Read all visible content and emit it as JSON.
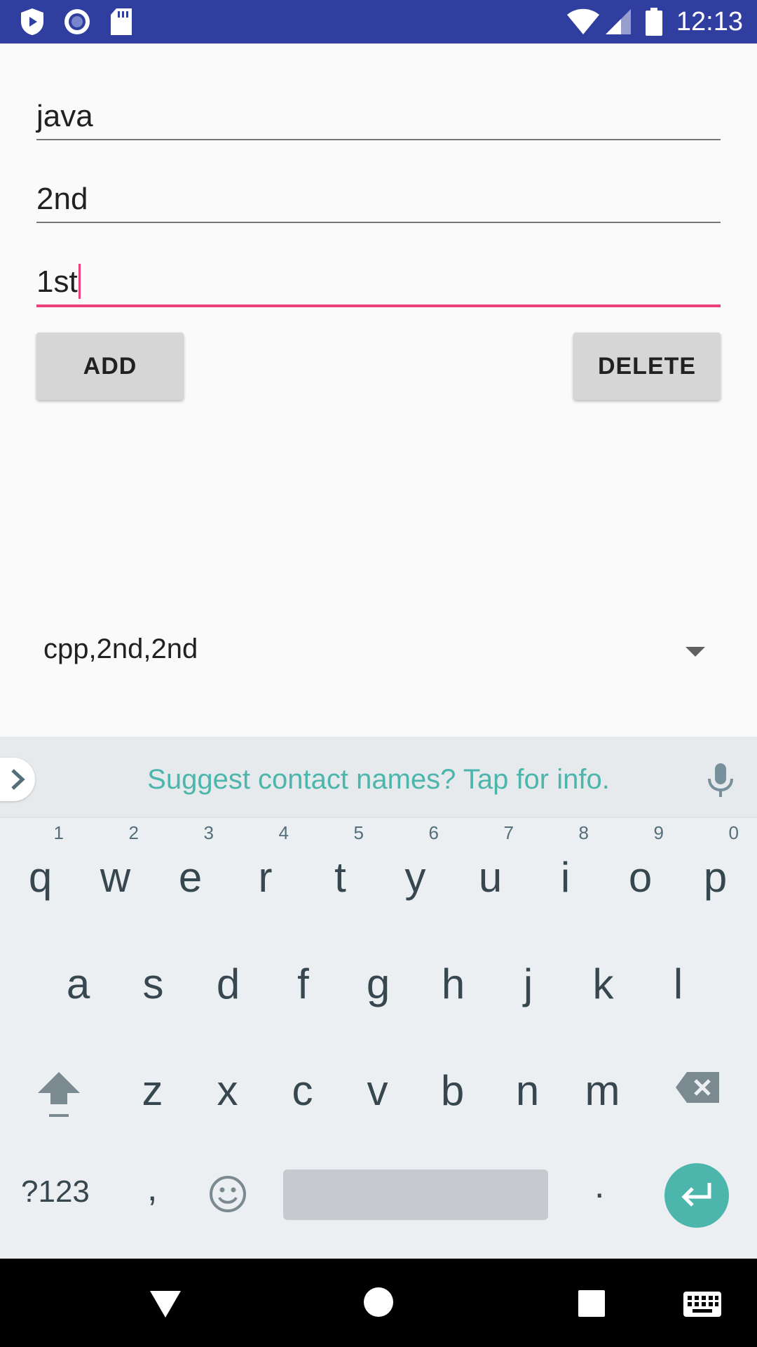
{
  "status_bar": {
    "time": "12:13",
    "icons": [
      "shield-play-icon",
      "record-icon",
      "sd-card-icon",
      "wifi-icon",
      "signal-icon",
      "battery-icon"
    ],
    "background": "#303f9f"
  },
  "form": {
    "field_1": "java",
    "field_2": "2nd",
    "field_3": "1st",
    "accent": "#ec407a"
  },
  "buttons": {
    "add": "ADD",
    "delete": "DELETE"
  },
  "spinner": {
    "selected": "cpp,2nd,2nd"
  },
  "keyboard": {
    "suggestion": "Suggest contact names? Tap for info.",
    "row1": [
      {
        "key": "q",
        "hint": "1"
      },
      {
        "key": "w",
        "hint": "2"
      },
      {
        "key": "e",
        "hint": "3"
      },
      {
        "key": "r",
        "hint": "4"
      },
      {
        "key": "t",
        "hint": "5"
      },
      {
        "key": "y",
        "hint": "6"
      },
      {
        "key": "u",
        "hint": "7"
      },
      {
        "key": "i",
        "hint": "8"
      },
      {
        "key": "o",
        "hint": "9"
      },
      {
        "key": "p",
        "hint": "0"
      }
    ],
    "row2": [
      "a",
      "s",
      "d",
      "f",
      "g",
      "h",
      "j",
      "k",
      "l"
    ],
    "row3": [
      "z",
      "x",
      "c",
      "v",
      "b",
      "n",
      "m"
    ],
    "symbols_key": "?123",
    "comma_key": ",",
    "period_key": ".",
    "accent": "#4db6ac"
  },
  "nav_bar": {
    "icons": [
      "back-icon",
      "home-icon",
      "recents-icon",
      "keyboard-switch-icon"
    ]
  }
}
